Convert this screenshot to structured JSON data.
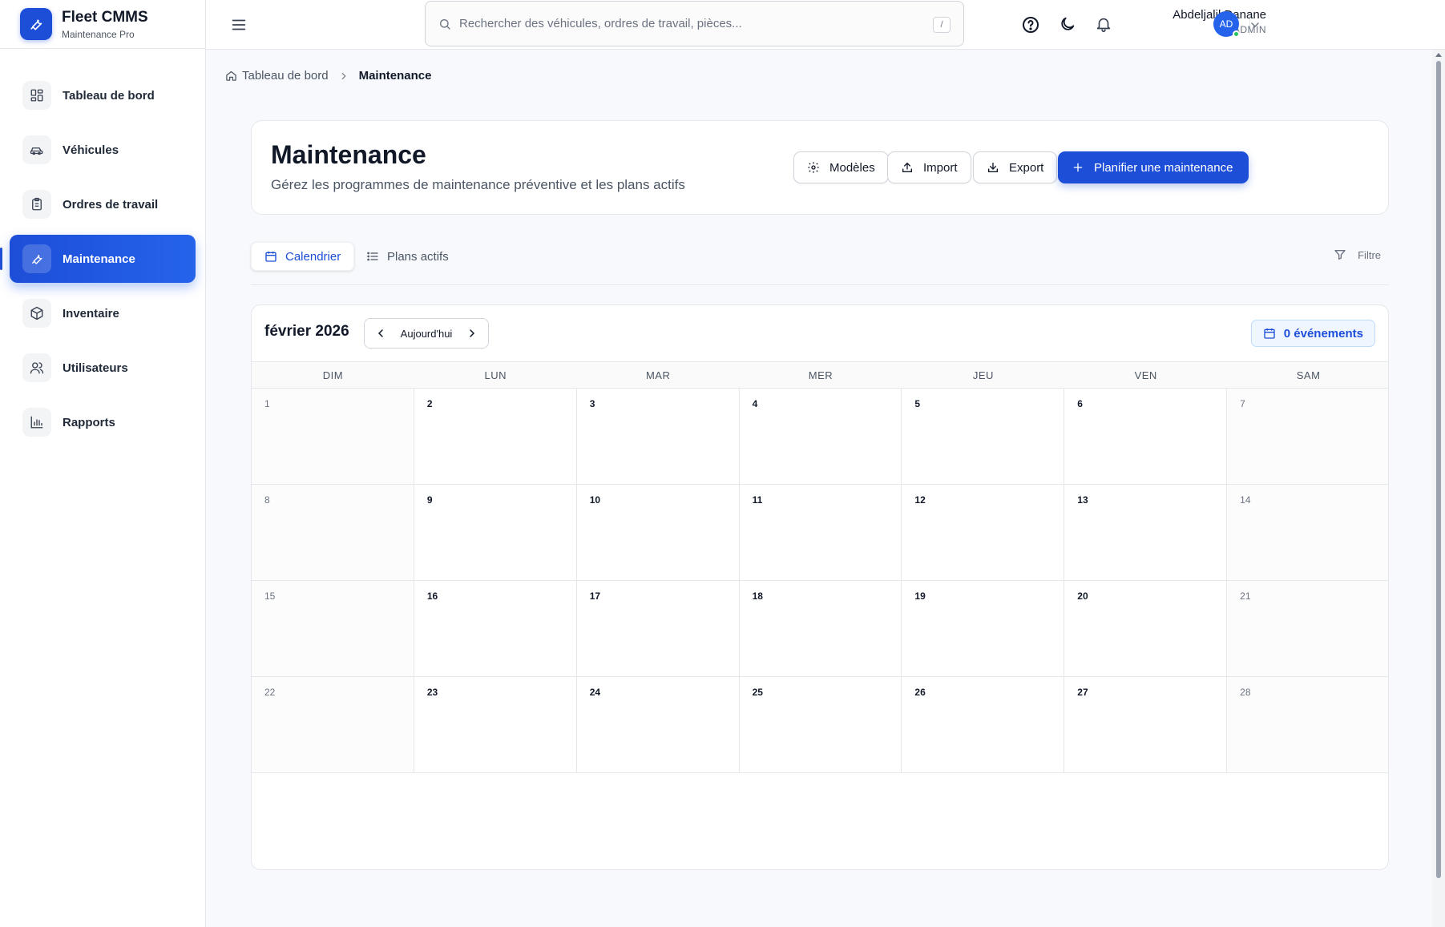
{
  "brand": {
    "title": "Fleet CMMS",
    "subtitle": "Maintenance Pro"
  },
  "sidebar": {
    "items": [
      {
        "label": "Tableau de bord",
        "icon": "dashboard-icon"
      },
      {
        "label": "Véhicules",
        "icon": "car-icon"
      },
      {
        "label": "Ordres de travail",
        "icon": "clipboard-icon"
      },
      {
        "label": "Maintenance",
        "icon": "wrench-icon",
        "active": true
      },
      {
        "label": "Inventaire",
        "icon": "box-icon"
      },
      {
        "label": "Utilisateurs",
        "icon": "users-icon"
      },
      {
        "label": "Rapports",
        "icon": "bar-chart-icon"
      }
    ]
  },
  "search": {
    "placeholder": "Rechercher des véhicules, ordres de travail, pièces...",
    "shortcut": "/"
  },
  "user": {
    "name": "Abdeljalil Danane",
    "role": "ADMIN",
    "initials": "AD"
  },
  "breadcrumb": {
    "home": "Tableau de bord",
    "current": "Maintenance"
  },
  "header": {
    "title": "Maintenance",
    "subtitle": "Gérez les programmes de maintenance préventive et les plans actifs",
    "buttons": {
      "templates": "Modèles",
      "import": "Import",
      "export": "Export",
      "schedule": "Planifier une maintenance"
    }
  },
  "tabs": {
    "calendar": "Calendrier",
    "active_plans": "Plans actifs",
    "filter": "Filtre"
  },
  "calendar": {
    "month_label": "février 2026",
    "today_label": "Aujourd'hui",
    "events_label": "0 événements",
    "weekdays": [
      "DIM",
      "LUN",
      "MAR",
      "MER",
      "JEU",
      "VEN",
      "SAM"
    ],
    "days": [
      "1",
      "2",
      "3",
      "4",
      "5",
      "6",
      "7",
      "8",
      "9",
      "10",
      "11",
      "12",
      "13",
      "14",
      "15",
      "16",
      "17",
      "18",
      "19",
      "20",
      "21",
      "22",
      "23",
      "24",
      "25",
      "26",
      "27",
      "28"
    ]
  },
  "colors": {
    "accent": "#1d4ed8",
    "online": "#22c55e"
  }
}
